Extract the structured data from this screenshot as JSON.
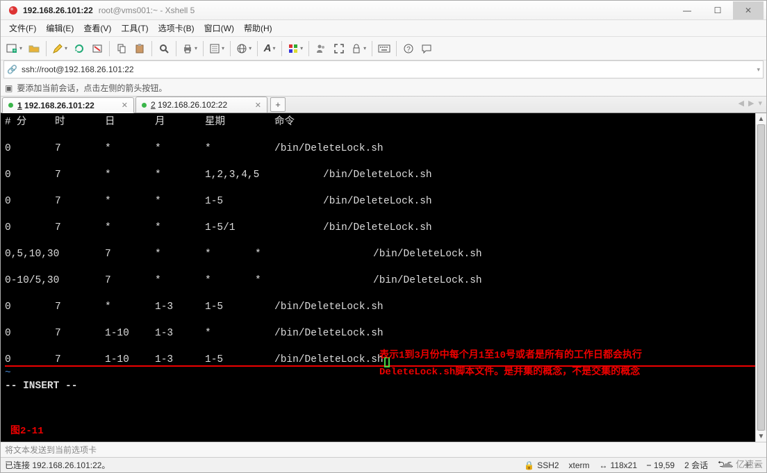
{
  "title": {
    "ip": "192.168.26.101:22",
    "session": "root@vms001:~ - Xshell 5"
  },
  "menu": {
    "file": "文件(F)",
    "edit": "编辑(E)",
    "view": "查看(V)",
    "tools": "工具(T)",
    "tabs": "选项卡(B)",
    "window": "窗口(W)",
    "help": "帮助(H)"
  },
  "address": {
    "url": "ssh://root@192.168.26.101:22"
  },
  "hint": {
    "text": "要添加当前会话，点击左侧的箭头按钮。"
  },
  "tabs": {
    "items": [
      {
        "index": "1",
        "label": "192.168.26.101:22",
        "active": true
      },
      {
        "index": "2",
        "label": "192.168.26.102:22",
        "active": false
      }
    ],
    "add": "+"
  },
  "terminal": {
    "header": {
      "hash": "#",
      "min": "分",
      "hr": "时",
      "day": "日",
      "mon": "月",
      "wk": "星期",
      "cmd": "命令"
    },
    "rows": [
      {
        "min": "0",
        "hr": "7",
        "day": "*",
        "mon": "*",
        "wk": "*",
        "cmd": "/bin/DeleteLock.sh",
        "blank_after": true
      },
      {
        "min": "0",
        "hr": "7",
        "day": "*",
        "mon": "*",
        "wk": "1,2,3,4,5",
        "cmd": "/bin/DeleteLock.sh",
        "indent_cmd": true,
        "blank_after": true
      },
      {
        "min": "0",
        "hr": "7",
        "day": "*",
        "mon": "*",
        "wk": "1-5",
        "cmd": "/bin/DeleteLock.sh",
        "indent_cmd": true,
        "blank_after": true
      },
      {
        "min": "0",
        "hr": "7",
        "day": "*",
        "mon": "*",
        "wk": "1-5/1",
        "cmd": "/bin/DeleteLock.sh",
        "indent_cmd": true,
        "blank_after": true
      },
      {
        "min": "0,5,10,30",
        "hr": "7",
        "day": "*",
        "mon": "*",
        "wk": "*",
        "cmd": "/bin/DeleteLock.sh",
        "wide_first": true,
        "indent_cmd": true,
        "blank_after": true
      },
      {
        "min": "0-10/5,30",
        "hr": "7",
        "day": "*",
        "mon": "*",
        "wk": "*",
        "cmd": "/bin/DeleteLock.sh",
        "wide_first": true,
        "indent_cmd": true,
        "blank_after": true
      },
      {
        "min": "0",
        "hr": "7",
        "day": "*",
        "mon": "1-3",
        "wk": "1-5",
        "cmd": "/bin/DeleteLock.sh",
        "blank_after": true
      },
      {
        "min": "0",
        "hr": "7",
        "day": "1-10",
        "mon": "1-3",
        "wk": "*",
        "cmd": "/bin/DeleteLock.sh",
        "blank_after": true
      },
      {
        "min": "0",
        "hr": "7",
        "day": "1-10",
        "mon": "1-3",
        "wk": "1-5",
        "cmd": "/bin/DeleteLock.sh",
        "underline": true,
        "cursor": true
      }
    ],
    "tilde": "~",
    "mode": "-- INSERT --",
    "annotation_line1": "表示1到3月份中每个月1至10号或者是所有的工作日都会执行",
    "annotation_line2": "DeleteLock.sh脚本文件。是并集的概念，不是交集的概念",
    "figure": "图2-11"
  },
  "prompt": {
    "text": "将文本发送到当前选项卡"
  },
  "status": {
    "connected": "已连接 192.168.26.101:22。",
    "proto": "SSH2",
    "term": "xterm",
    "size": "118x21",
    "cursor": "19,59",
    "sessions": "2 会话",
    "arrows_left": "‹ ›",
    "resize": "↔",
    "plus": "+ ‒"
  },
  "brand": "亿速云"
}
